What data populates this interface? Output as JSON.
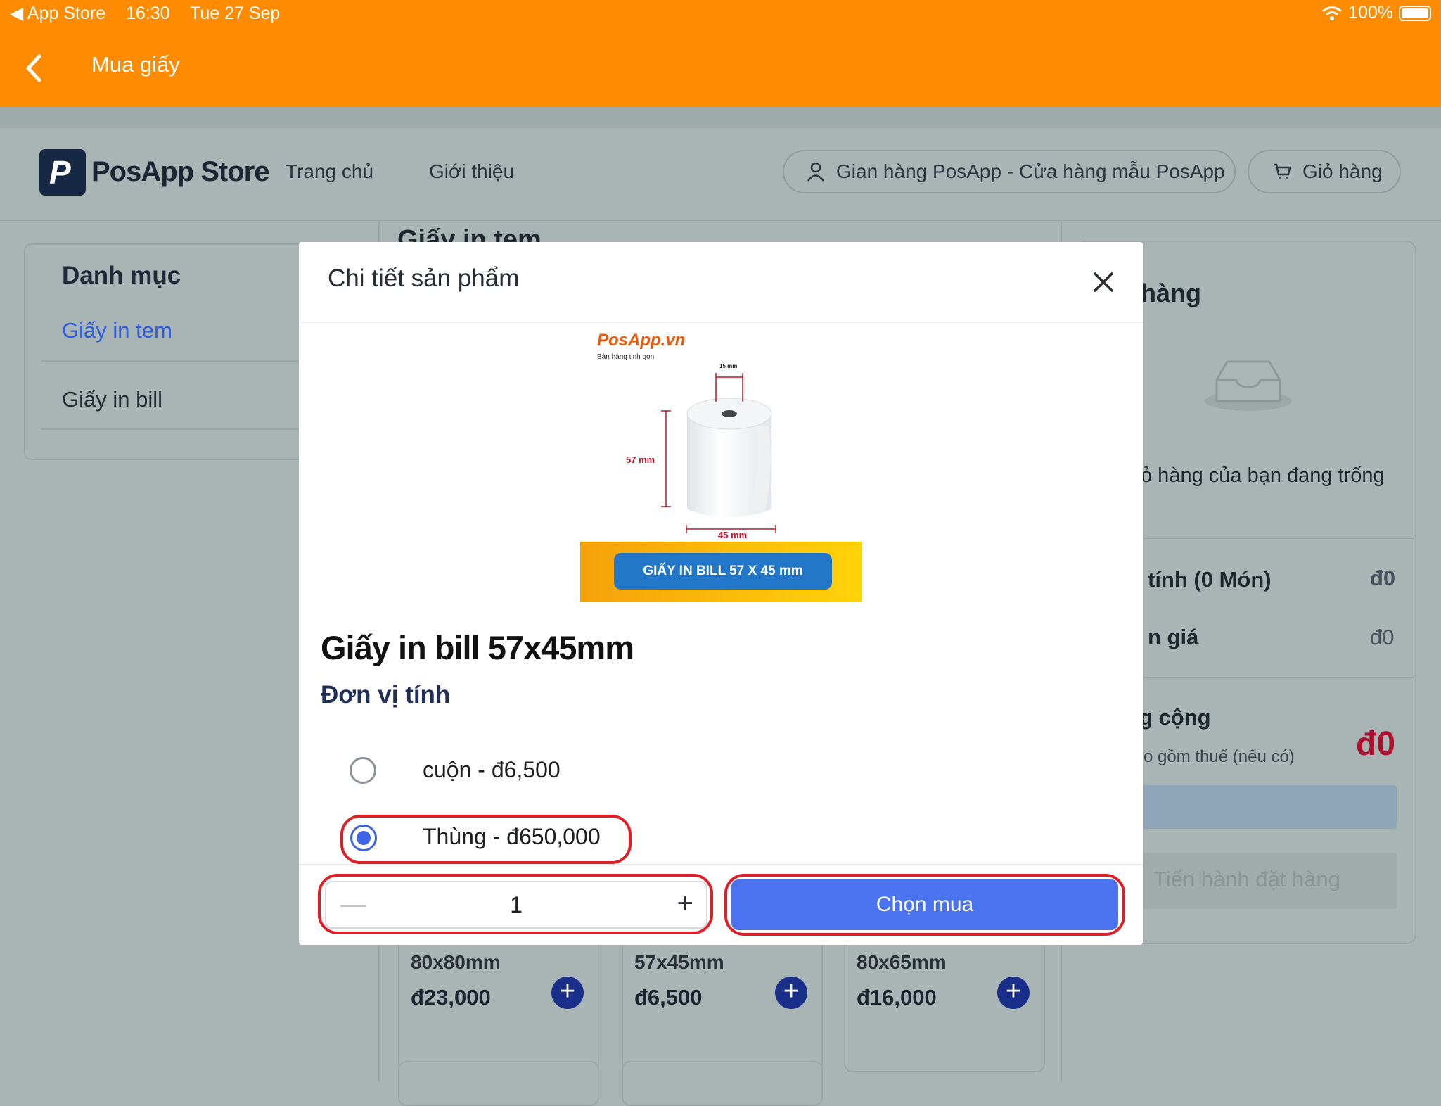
{
  "status_bar": {
    "back_app": "◀ App Store",
    "time": "16:30",
    "date": "Tue 27 Sep",
    "wifi": "wifi-icon",
    "battery": "100%"
  },
  "app_bar": {
    "title": "Mua giấy"
  },
  "store_nav": {
    "brand": "PosApp Store",
    "links": [
      "Trang chủ",
      "Giới thiệu"
    ],
    "shop_button": "Gian hàng PosApp - Cửa hàng mẫu PosApp",
    "cart_button": "Giỏ hàng"
  },
  "sidebar": {
    "heading": "Danh mục",
    "items": [
      "Giấy in tem",
      "Giấy in bill"
    ]
  },
  "main": {
    "heading_partial": "Giấy in tem"
  },
  "cart": {
    "heading_partial": "hàng",
    "empty_text": "ỏ hàng của bạn đang trống",
    "subtotal_label": "tính (0 Món)",
    "subtotal_value": "đ0",
    "discount_label": "n giá",
    "discount_value": "đ0",
    "total_label": "g cộng",
    "total_note": "o gồm thuế (nếu có)",
    "total_value": "đ0",
    "checkout_label": "Tiến hành đặt hàng"
  },
  "products": [
    {
      "name": "80x80mm",
      "price": "đ23,000"
    },
    {
      "name": "57x45mm",
      "price": "đ6,500"
    },
    {
      "name": "80x65mm",
      "price": "đ16,000"
    }
  ],
  "modal": {
    "title": "Chi tiết sản phẩm",
    "image": {
      "brand": "PosApp.vn",
      "tagline": "Bán hàng tinh gọn",
      "dim_top": "15 mm",
      "dim_left": "57 mm",
      "dim_bottom": "45 mm",
      "banner": "GIẤY IN BILL 57 X 45 mm"
    },
    "product_title": "Giấy in bill 57x45mm",
    "unit_label": "Đơn vị tính",
    "options": [
      {
        "label": "cuộn - đ6,500",
        "selected": false
      },
      {
        "label": "Thùng - đ650,000",
        "selected": true
      }
    ],
    "quantity": "1",
    "buy_button": "Chọn mua"
  },
  "colors": {
    "app_bar": "#ff8c00",
    "primary": "#4b72ef",
    "highlight": "#e01e26",
    "overlay": "#a9b4b4"
  }
}
